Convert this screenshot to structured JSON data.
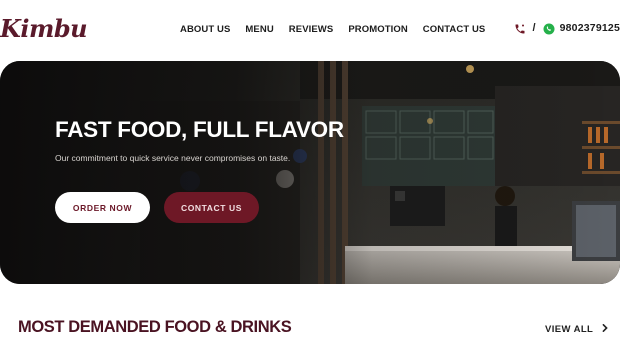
{
  "brand": {
    "logo_text": "Kimbu"
  },
  "nav": {
    "items": [
      {
        "label": "ABOUT US"
      },
      {
        "label": "MENU"
      },
      {
        "label": "REVIEWS"
      },
      {
        "label": "PROMOTION"
      },
      {
        "label": "CONTACT US"
      }
    ]
  },
  "contact": {
    "phone_icon": "phone-icon",
    "whatsapp_icon": "whatsapp-icon",
    "separator": "/",
    "number": "9802379125"
  },
  "hero": {
    "title": "FAST FOOD, FULL FLAVOR",
    "subtitle": "Our commitment to quick service never compromises on taste.",
    "primary_button": "ORDER NOW",
    "secondary_button": "CONTACT US"
  },
  "section": {
    "title": "MOST DEMANDED FOOD & DRINKS",
    "view_all": "VIEW ALL",
    "view_all_icon": "chevron-right-icon"
  },
  "colors": {
    "brand": "#5a1a2b",
    "button_dark": "#6e1826",
    "button_light": "#ffffff"
  }
}
